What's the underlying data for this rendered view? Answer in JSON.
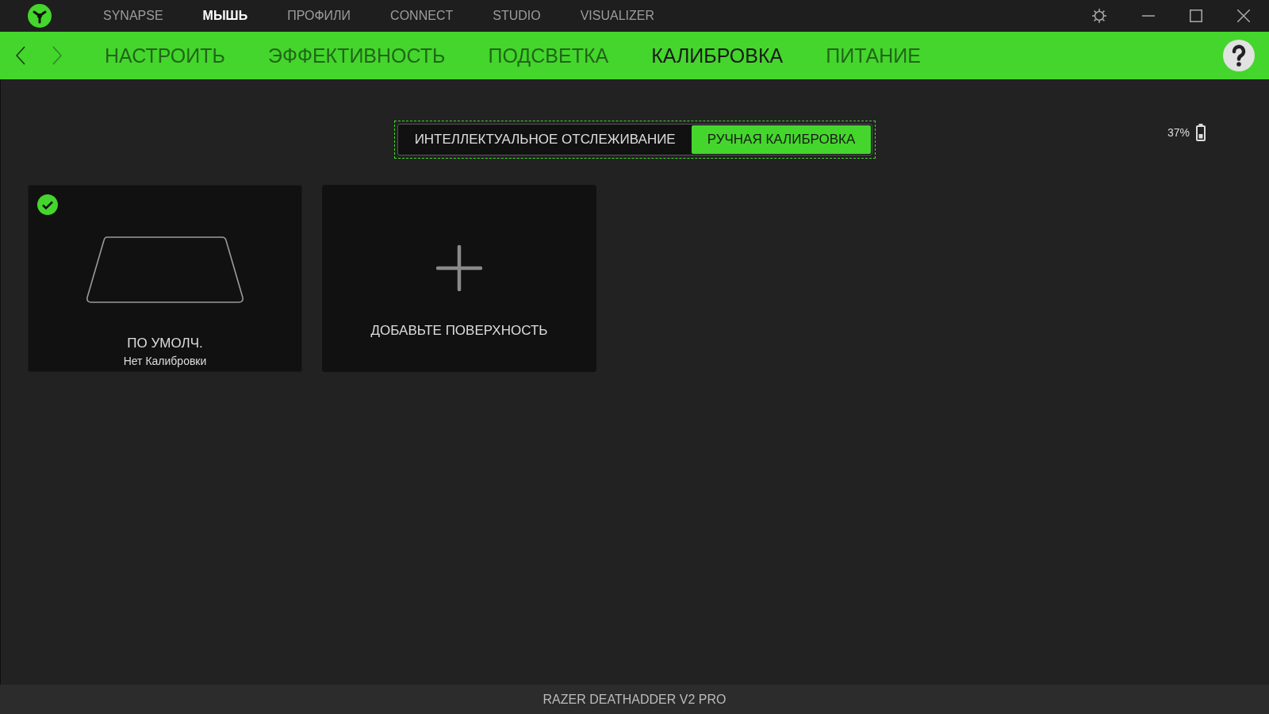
{
  "top_nav": [
    {
      "label": "SYNAPSE",
      "selected": false
    },
    {
      "label": "МЫШЬ",
      "selected": true
    },
    {
      "label": "ПРОФИЛИ",
      "selected": false
    },
    {
      "label": "CONNECT",
      "selected": false
    },
    {
      "label": "STUDIO",
      "selected": false
    },
    {
      "label": "VISUALIZER",
      "selected": false
    }
  ],
  "history": {
    "back_disabled": false,
    "forward_disabled": true
  },
  "sub_tabs": [
    {
      "label": "НАСТРОИТЬ",
      "selected": false
    },
    {
      "label": "ЭФФЕКТИВНОСТЬ",
      "selected": false
    },
    {
      "label": "ПОДСВЕТКА",
      "selected": false
    },
    {
      "label": "КАЛИБРОВКА",
      "selected": true
    },
    {
      "label": "ПИТАНИЕ",
      "selected": false
    }
  ],
  "mode_toggle": [
    {
      "label": "ИНТЕЛЛЕКТУАЛЬНОЕ ОТСЛЕЖИВАНИЕ",
      "selected": false
    },
    {
      "label": "РУЧНАЯ КАЛИБРОВКА",
      "selected": true
    }
  ],
  "battery": {
    "reading": "37%"
  },
  "surfaces": [
    {
      "kind": "surface",
      "title": "ПО УМОЛЧ.",
      "subtitle": "Нет Калибровки",
      "selected": true
    },
    {
      "kind": "add",
      "title": "ДОБАВЬТЕ ПОВЕРХНОСТЬ",
      "selected": false
    }
  ],
  "status_bar": {
    "device": "RAZER DEATHADDER V2 PRO"
  }
}
